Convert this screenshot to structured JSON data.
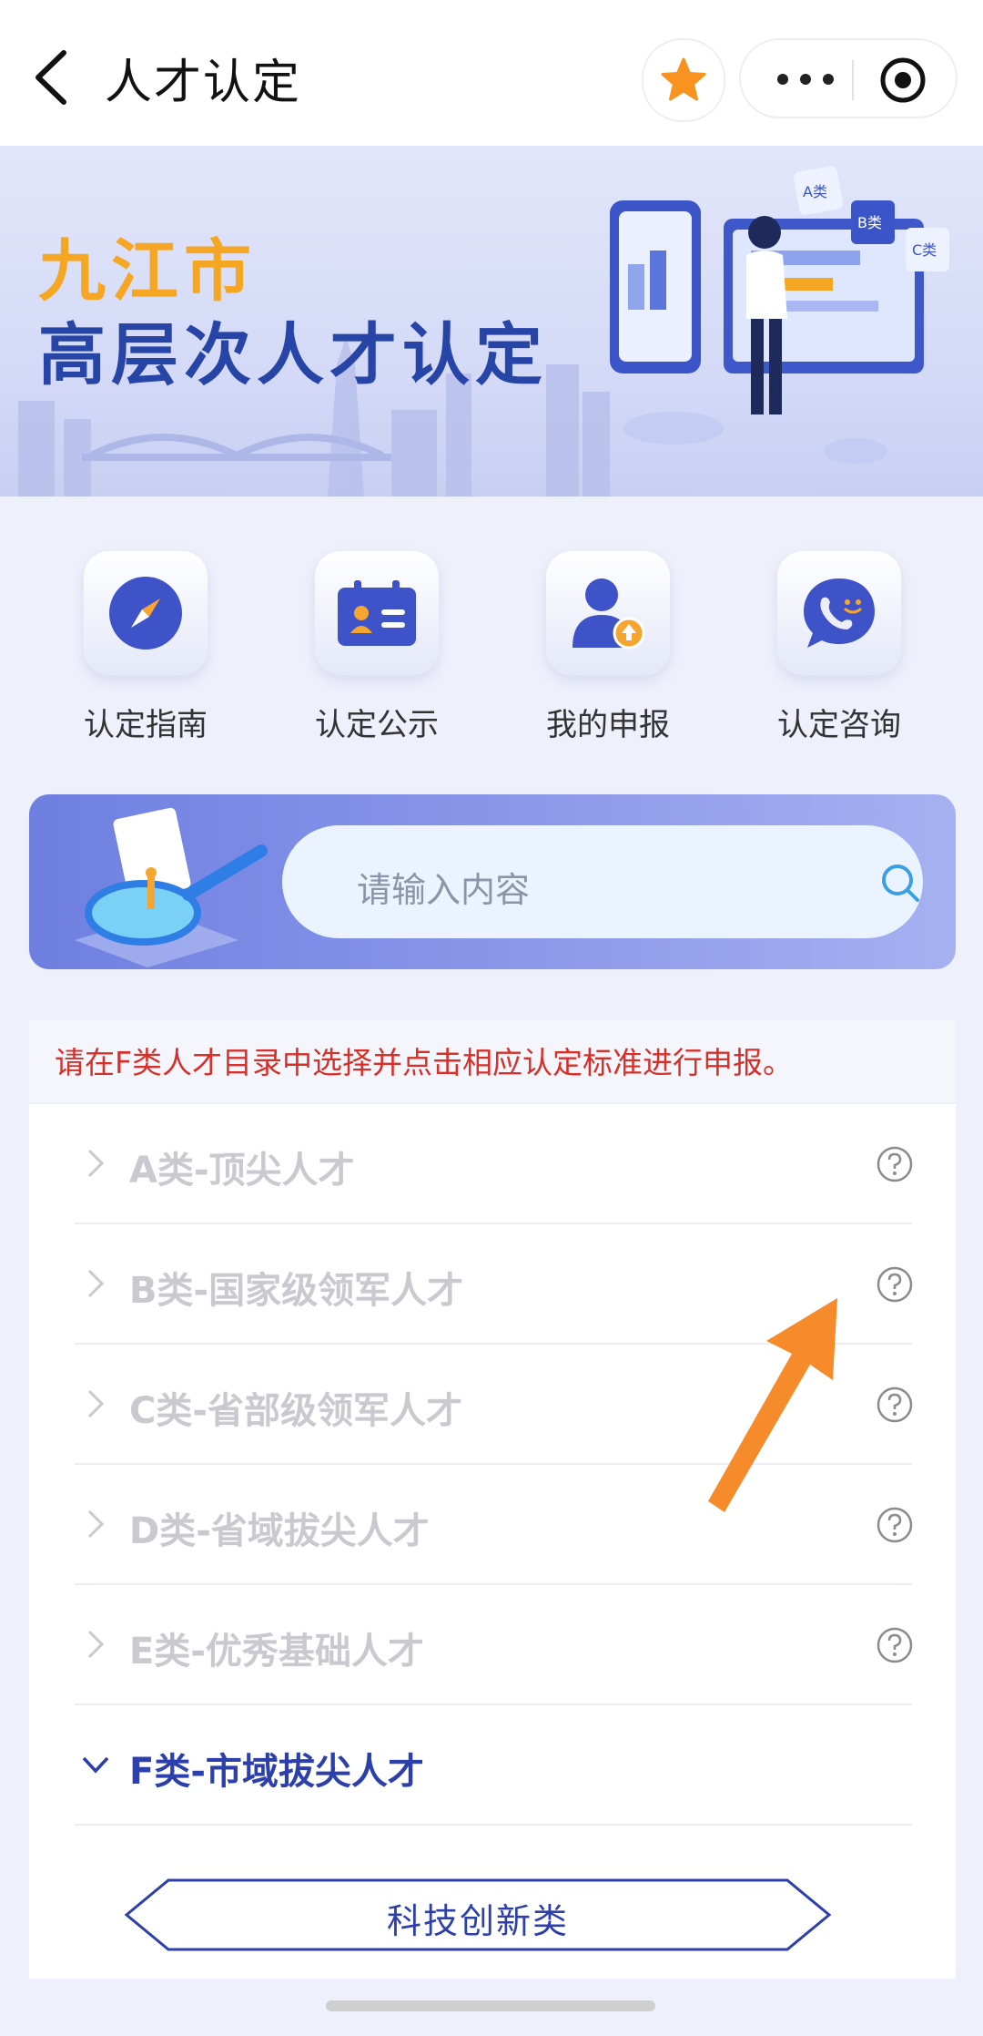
{
  "header": {
    "title": "人才认定"
  },
  "banner": {
    "line1": "九江市",
    "line2": "高层次人才认定",
    "card_labels": [
      "A类",
      "B类",
      "C类"
    ]
  },
  "quick_entries": [
    {
      "label": "认定指南",
      "icon": "compass-icon"
    },
    {
      "label": "认定公示",
      "icon": "id-card-icon"
    },
    {
      "label": "我的申报",
      "icon": "user-upload-icon"
    },
    {
      "label": "认定咨询",
      "icon": "chat-bubble-icon"
    }
  ],
  "search": {
    "placeholder": "请输入内容"
  },
  "notice": "请在F类人才目录中选择并点击相应认定标准进行申报。",
  "categories": [
    {
      "label": "A类-顶尖人才"
    },
    {
      "label": "B类-国家级领军人才"
    },
    {
      "label": "C类-省部级领军人才"
    },
    {
      "label": "D类-省域拔尖人才"
    },
    {
      "label": "E类-优秀基础人才"
    },
    {
      "label": "F类-市域拔尖人才"
    }
  ],
  "subcategory": {
    "label": "科技创新类"
  },
  "colors": {
    "accent": "#2d3faa",
    "star": "#f7931e",
    "notice": "#d6302b",
    "disabled_text": "#c9c9cf",
    "annotation_arrow": "#f68b2c"
  }
}
